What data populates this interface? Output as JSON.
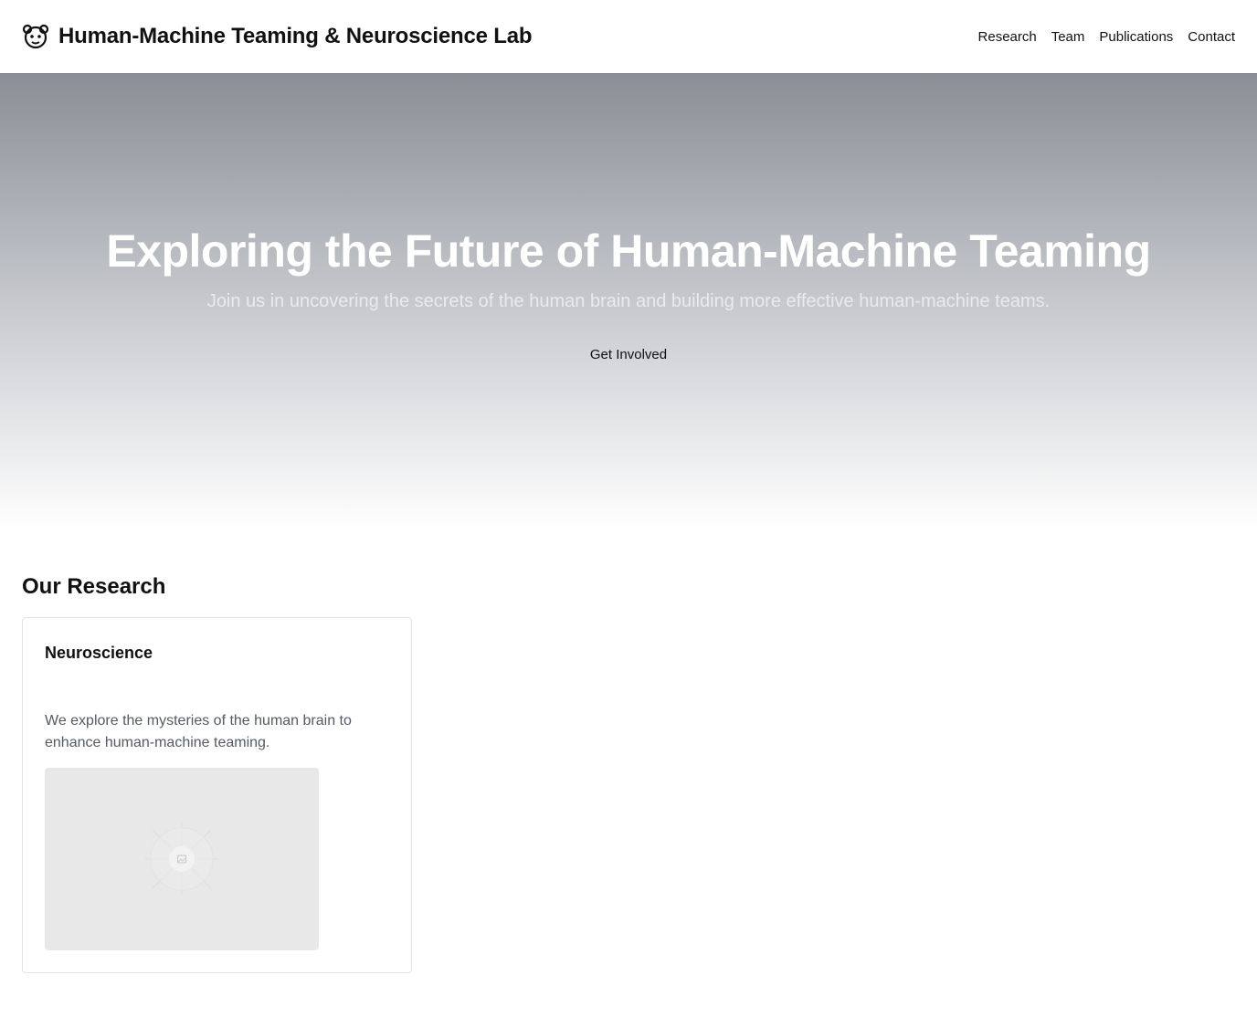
{
  "header": {
    "title": "Human-Machine Teaming & Neuroscience Lab",
    "logo_icon": "brain-face-icon",
    "nav": [
      {
        "label": "Research"
      },
      {
        "label": "Team"
      },
      {
        "label": "Publications"
      },
      {
        "label": "Contact"
      }
    ]
  },
  "hero": {
    "title": "Exploring the Future of Human-Machine Teaming",
    "subtitle": "Join us in uncovering the secrets of the human brain and building more effective human-machine teams.",
    "cta_label": "Get Involved"
  },
  "research": {
    "section_title": "Our Research",
    "cards": [
      {
        "title": "Neuroscience",
        "description": "We explore the mysteries of the human brain to enhance human-machine teaming.",
        "image_icon": "image-placeholder-icon"
      }
    ]
  },
  "colors": {
    "hero_gradient_top": "#8b8e96",
    "hero_gradient_bottom": "#ffffff",
    "card_border": "#e3e3e3",
    "placeholder_bg": "#e8e8e8"
  }
}
